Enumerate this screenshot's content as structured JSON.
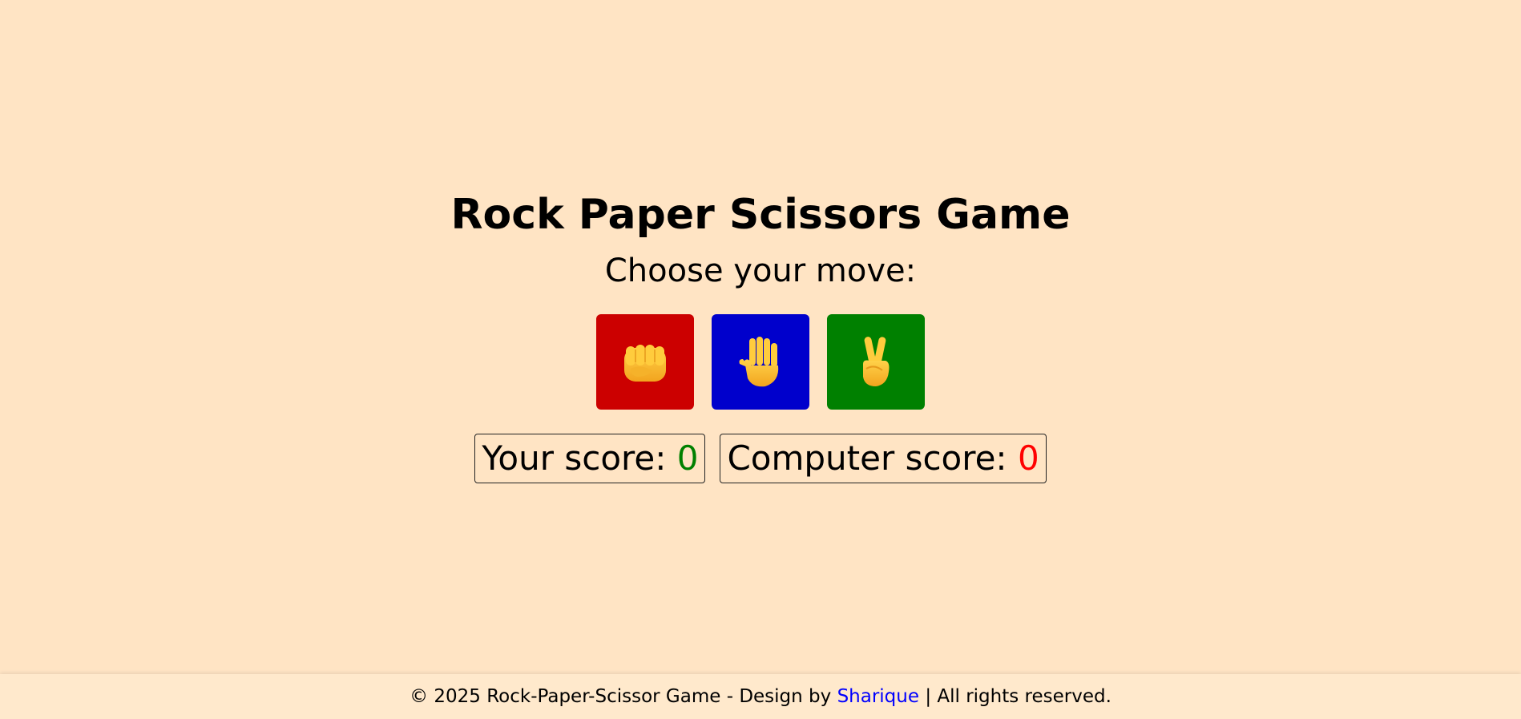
{
  "header": {
    "title": "Rock Paper Scissors Game",
    "subtitle": "Choose your move:"
  },
  "choices": [
    {
      "name": "rock",
      "icon": "fist-icon",
      "color": "#cc0000"
    },
    {
      "name": "paper",
      "icon": "raised-hand-icon",
      "color": "#0000cc"
    },
    {
      "name": "scissors",
      "icon": "victory-hand-icon",
      "color": "#008000"
    }
  ],
  "scores": {
    "user_label": "Your score: ",
    "user_value": "0",
    "user_color": "#008000",
    "computer_label": "Computer score: ",
    "computer_value": "0",
    "computer_color": "#ff0000"
  },
  "footer": {
    "prefix": "© 2025 Rock-Paper-Scissor Game - Design by ",
    "author": "Sharique",
    "author_color": "#0000ff",
    "suffix": " | All rights reserved."
  }
}
